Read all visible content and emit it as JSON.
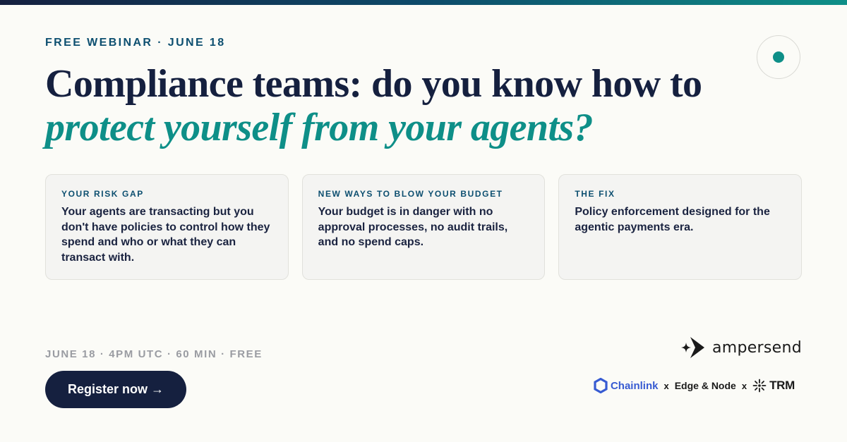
{
  "colors": {
    "navy": "#15203f",
    "teal": "#0e8f88",
    "label_blue": "#0d4f70",
    "muted": "#9a9ca2",
    "chainlink_blue": "#375bd2"
  },
  "header": {
    "eyebrow": "FREE WEBINAR · JUNE 18",
    "title_line1": "Compliance teams: do you know how to",
    "title_line2": "protect yourself from your agents?"
  },
  "cards": [
    {
      "label": "YOUR RISK GAP",
      "body": "Your agents are transacting but you don't have policies to control how they spend and who or what they can transact with."
    },
    {
      "label": "NEW WAYS TO BLOW YOUR BUDGET",
      "body": "Your budget is in danger with no approval processes, no audit trails, and no spend caps."
    },
    {
      "label": "THE FIX",
      "body": "Policy enforcement designed for the agentic payments era."
    }
  ],
  "footer": {
    "event_meta": "JUNE 18 · 4PM UTC · 60 MIN · FREE",
    "register_label": "Register now →"
  },
  "brand": {
    "name": "ampersend",
    "icon": "ampersend-logo-icon"
  },
  "partners": {
    "chainlink": "Chainlink",
    "sep1": "x",
    "edge_node": "Edge & Node",
    "sep2": "x",
    "trm": "TRM"
  }
}
